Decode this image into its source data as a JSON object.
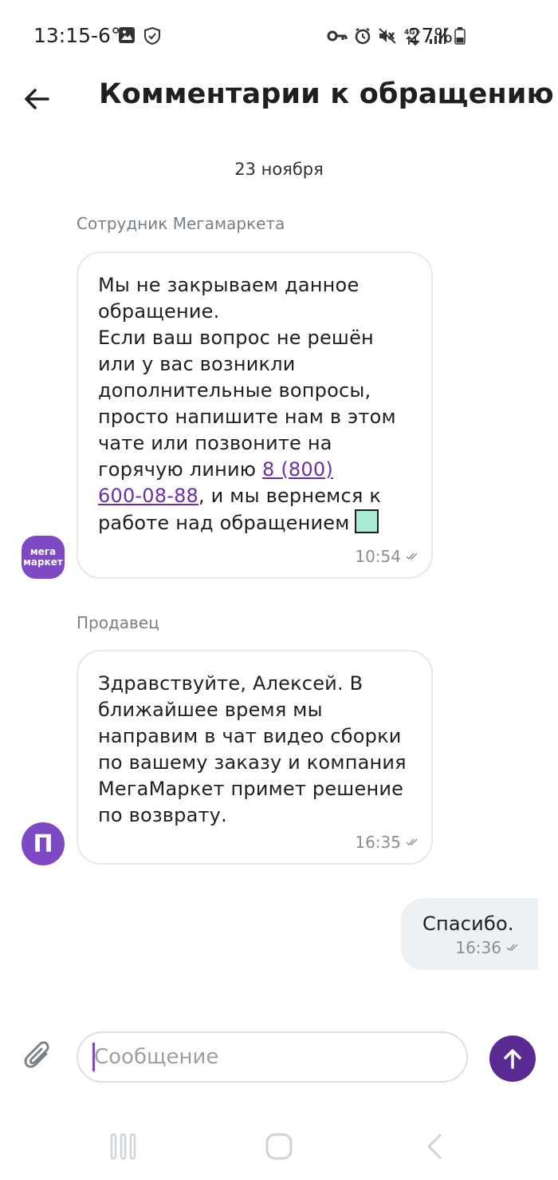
{
  "status_bar": {
    "time": "13:15",
    "temperature": "-6°",
    "battery": "27%"
  },
  "header": {
    "title": "Комментарии к обращению"
  },
  "chat": {
    "date": "23 ноября",
    "messages": [
      {
        "sender": "Сотрудник Мегамаркета",
        "avatar_text": "мега\nмаркет",
        "text_before_link": "Мы не закрываем данное\nобращение.\nЕсли ваш вопрос не решён\nили у вас возникли\nдополнительные вопросы,\nпросто напишите нам в этом\nчате или позвоните на\nгорячую линию ",
        "link_text": "8 (800)\n600-08-88",
        "text_after_link": ", и мы вернемся к\nработе над обращением",
        "time": "10:54"
      },
      {
        "sender": "Продавец",
        "avatar_text": "П",
        "text": "Здравствуйте, Алексей. В\nближайшее время мы\nнаправим в чат видео сборки\nпо вашему заказу и компания\nМегаМаркет примет решение\nпо возврату.",
        "time": "16:35"
      },
      {
        "sender": "me",
        "text": "Спасибо.",
        "time": "16:36"
      }
    ]
  },
  "composer": {
    "placeholder": "Сообщение",
    "value": ""
  },
  "icons": {
    "back": "arrow-left-icon",
    "attach": "paperclip-icon",
    "send": "arrow-up-icon",
    "read": "double-check-icon"
  },
  "colors": {
    "accent": "#7e49c4",
    "send_button": "#5a2a93",
    "link": "#6a2fa8",
    "my_bubble": "#eef1f3"
  }
}
